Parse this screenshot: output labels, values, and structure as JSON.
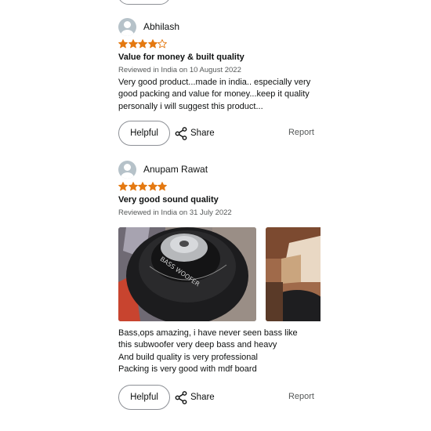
{
  "reviews": [
    {
      "reviewer": "Abhilash",
      "rating": 4,
      "max_rating": 5,
      "title": "Value for money & built quality",
      "date": "Reviewed in India on 10 August 2022",
      "body": "Very good product...made in india.. especially very good packing and value for money...keep it quality personally i will suggest this product...",
      "helpful_label": "Helpful",
      "share_label": "Share",
      "report_label": "Report"
    },
    {
      "reviewer": "Anupam Rawat",
      "rating": 5,
      "max_rating": 5,
      "title": "Very good sound quality",
      "date": "Reviewed in India on 31 July 2022",
      "body": "Bass,ops amazing, i have never seen bass like\nthis subwoofer very deep bass and heavy\nAnd build quality is very professional\nPacking is very good with mdf board",
      "image_labels": [
        "BASS WOOFER"
      ],
      "helpful_label": "Helpful",
      "share_label": "Share",
      "report_label": "Report"
    }
  ],
  "colors": {
    "star": "#e47911",
    "star_empty_stroke": "#e47911",
    "text": "#0f1111",
    "muted": "#565959",
    "button_border": "#8d9096",
    "avatar": "#b6c2c9"
  },
  "icons": [
    "user-avatar-icon",
    "star-icon",
    "share-icon"
  ]
}
